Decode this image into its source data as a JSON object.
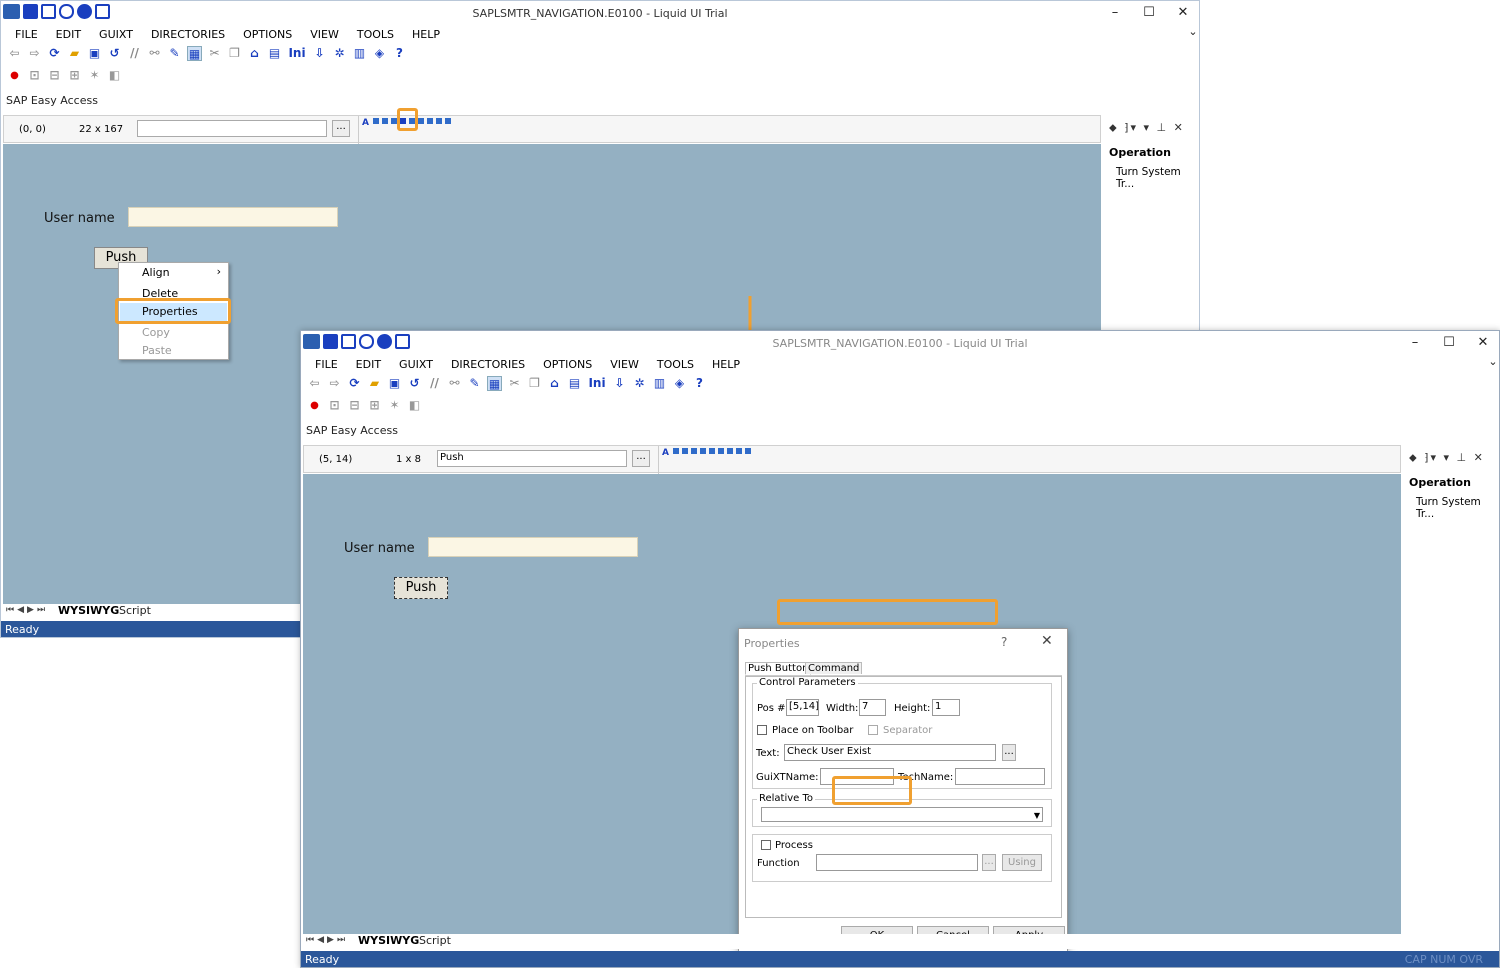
{
  "back_window": {
    "title": "SAPLSMTR_NAVIGATION.E0100 - Liquid UI Trial",
    "window_controls": {
      "minimize": "–",
      "maximize": "☐",
      "close": "✕",
      "collapse": "⌄"
    },
    "menu": [
      "FILE",
      "EDIT",
      "GUIXT",
      "DIRECTORIES",
      "OPTIONS",
      "VIEW",
      "TOOLS",
      "HELP"
    ],
    "toolbar_text": {
      "comment": "//",
      "ini": "Ini"
    },
    "breadcrumb": "SAP Easy Access",
    "editor": {
      "pos": "(0, 0)",
      "size": "22 x 167",
      "text_value": "",
      "browse_label": "..."
    },
    "canvas": {
      "username_label": "User name",
      "push_label": "Push"
    },
    "context_menu": {
      "items": [
        "Align",
        "Delete",
        "Properties",
        "Copy",
        "Paste"
      ],
      "submenu_arrow": "›",
      "highlighted": "Properties"
    },
    "right_panel": {
      "pane_tools": "⬥ ⁆▾ ▾ ⊥ ✕",
      "group": "Operation",
      "item": "Turn System Tr..."
    },
    "tabs": {
      "nav": "⏮◀▶⏭",
      "wysiwyg": "WYSIWYG",
      "script": "Script"
    },
    "status": "Ready"
  },
  "front_window": {
    "title": "SAPLSMTR_NAVIGATION.E0100 - Liquid UI Trial",
    "window_controls": {
      "minimize": "–",
      "maximize": "☐",
      "close": "✕",
      "collapse": "⌄"
    },
    "menu": [
      "FILE",
      "EDIT",
      "GUIXT",
      "DIRECTORIES",
      "OPTIONS",
      "VIEW",
      "TOOLS",
      "HELP"
    ],
    "toolbar_text": {
      "comment": "//",
      "ini": "Ini"
    },
    "breadcrumb": "SAP Easy Access",
    "editor": {
      "pos": "(5, 14)",
      "size": "1 x 8",
      "text_value": "Push",
      "browse_label": "..."
    },
    "canvas": {
      "username_label": "User name",
      "push_label": "Push"
    },
    "right_panel": {
      "pane_tools": "⬥ ⁆▾ ▾ ⊥ ✕",
      "group": "Operation",
      "item": "Turn System Tr..."
    },
    "tabs": {
      "nav": "⏮◀▶⏭",
      "wysiwyg": "WYSIWYG",
      "script": "Script"
    },
    "status": "Ready",
    "status_indicators": "CAP  NUM  OVR"
  },
  "properties_dialog": {
    "title": "Properties",
    "help": "?",
    "close": "✕",
    "tabs": [
      "Push Button",
      "Command"
    ],
    "control_parameters": {
      "group_title": "Control Parameters",
      "pos_label": "Pos #",
      "pos_value": "[5,14]",
      "width_label": "Width:",
      "width_value": "7",
      "height_label": "Height:",
      "height_value": "1",
      "place_on_toolbar_label": "Place on Toolbar",
      "separator_label": "Separator",
      "text_label": "Text:",
      "text_value": "Check User Exist",
      "text_browse": "...",
      "guixtname_label": "GuiXTName:",
      "guixtname_value": "",
      "techname_label": "TechName:",
      "techname_value": ""
    },
    "relative_to": {
      "group_title": "Relative To",
      "value": ""
    },
    "process": {
      "checkbox_label": "Process",
      "function_label": "Function",
      "function_value": "",
      "browse": "...",
      "using_label": "Using"
    },
    "buttons": {
      "ok": "OK",
      "cancel": "Cancel",
      "apply": "Apply"
    }
  },
  "colors": {
    "highlight": "#f0a030",
    "canvas": "#94b0c2",
    "statusbar": "#2b579a",
    "toolbar_blue": "#1a3fbf"
  }
}
